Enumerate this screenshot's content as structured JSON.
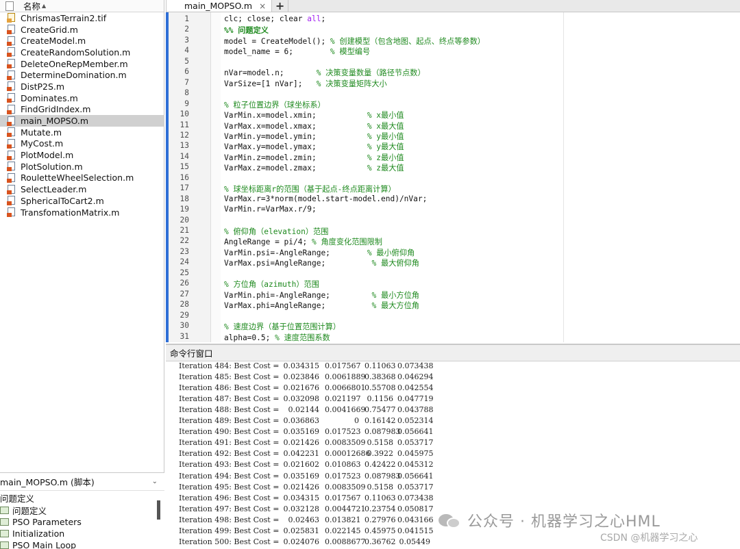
{
  "file_browser": {
    "header_label": "名称",
    "files": [
      {
        "name": "ChrismasTerrain2.tif",
        "type": "tif",
        "selected": false
      },
      {
        "name": "CreateGrid.m",
        "type": "m",
        "selected": false
      },
      {
        "name": "CreateModel.m",
        "type": "m",
        "selected": false
      },
      {
        "name": "CreateRandomSolution.m",
        "type": "m",
        "selected": false
      },
      {
        "name": "DeleteOneRepMember.m",
        "type": "m",
        "selected": false
      },
      {
        "name": "DetermineDomination.m",
        "type": "m",
        "selected": false
      },
      {
        "name": "DistP2S.m",
        "type": "m",
        "selected": false
      },
      {
        "name": "Dominates.m",
        "type": "m",
        "selected": false
      },
      {
        "name": "FindGridIndex.m",
        "type": "m",
        "selected": false
      },
      {
        "name": "main_MOPSO.m",
        "type": "m",
        "selected": true
      },
      {
        "name": "Mutate.m",
        "type": "m",
        "selected": false
      },
      {
        "name": "MyCost.m",
        "type": "m",
        "selected": false
      },
      {
        "name": "PlotModel.m",
        "type": "m",
        "selected": false
      },
      {
        "name": "PlotSolution.m",
        "type": "m",
        "selected": false
      },
      {
        "name": "RouletteWheelSelection.m",
        "type": "m",
        "selected": false
      },
      {
        "name": "SelectLeader.m",
        "type": "m",
        "selected": false
      },
      {
        "name": "SphericalToCart2.m",
        "type": "m",
        "selected": false
      },
      {
        "name": "TransfomationMatrix.m",
        "type": "m",
        "selected": false
      }
    ]
  },
  "script_panel": {
    "title": "main_MOPSO.m (脚本)",
    "root_section": "问题定义",
    "sections": [
      "问题定义",
      "PSO Parameters",
      "Initialization",
      "PSO Main Loop"
    ]
  },
  "editor": {
    "tab_label": "main_MOPSO.m",
    "tab_close": "×",
    "tab_add": "+",
    "lines": [
      {
        "n": "1",
        "code": "clc; close; clear all;"
      },
      {
        "n": "2",
        "code": "%% 问题定义"
      },
      {
        "n": "3",
        "code": "model = CreateModel(); % 创建模型（包含地图、起点、终点等参数）"
      },
      {
        "n": "4",
        "code": "model_name = 6;        % 模型编号"
      },
      {
        "n": "5",
        "code": ""
      },
      {
        "n": "6",
        "code": "nVar=model.n;       % 决策变量数量（路径节点数）"
      },
      {
        "n": "7",
        "code": "VarSize=[1 nVar];   % 决策变量矩阵大小"
      },
      {
        "n": "8",
        "code": ""
      },
      {
        "n": "9",
        "code": "% 粒子位置边界（球坐标系）"
      },
      {
        "n": "10",
        "code": "VarMin.x=model.xmin;           % x最小值"
      },
      {
        "n": "11",
        "code": "VarMax.x=model.xmax;           % x最大值"
      },
      {
        "n": "12",
        "code": "VarMin.y=model.ymin;           % y最小值"
      },
      {
        "n": "13",
        "code": "VarMax.y=model.ymax;           % y最大值"
      },
      {
        "n": "14",
        "code": "VarMin.z=model.zmin;           % z最小值"
      },
      {
        "n": "15",
        "code": "VarMax.z=model.zmax;           % z最大值"
      },
      {
        "n": "16",
        "code": ""
      },
      {
        "n": "17",
        "code": "% 球坐标距离r的范围（基于起点-终点距离计算）"
      },
      {
        "n": "18",
        "code": "VarMax.r=3*norm(model.start-model.end)/nVar;"
      },
      {
        "n": "19",
        "code": "VarMin.r=VarMax.r/9;"
      },
      {
        "n": "20",
        "code": ""
      },
      {
        "n": "21",
        "code": "% 俯仰角（elevation）范围"
      },
      {
        "n": "22",
        "code": "AngleRange = pi/4; % 角度变化范围限制"
      },
      {
        "n": "23",
        "code": "VarMin.psi=-AngleRange;        % 最小俯仰角"
      },
      {
        "n": "24",
        "code": "VarMax.psi=AngleRange;          % 最大俯仰角"
      },
      {
        "n": "25",
        "code": ""
      },
      {
        "n": "26",
        "code": "% 方位角（azimuth）范围"
      },
      {
        "n": "27",
        "code": "VarMin.phi=-AngleRange;         % 最小方位角"
      },
      {
        "n": "28",
        "code": "VarMax.phi=AngleRange;          % 最大方位角"
      },
      {
        "n": "29",
        "code": ""
      },
      {
        "n": "30",
        "code": "% 速度边界（基于位置范围计算）"
      },
      {
        "n": "31",
        "code": "alpha=0.5; % 速度范围系数"
      }
    ]
  },
  "command_window": {
    "title": "命令行窗口",
    "prompt": "«",
    "rows": [
      {
        "label": "Iteration 484: Best Cost =",
        "v": [
          "0.034315",
          "0.017567",
          "0.11063",
          "0.073438"
        ]
      },
      {
        "label": "Iteration 485: Best Cost =",
        "v": [
          "0.023846",
          "0.0061889",
          "0.38368",
          "0.046294"
        ]
      },
      {
        "label": "Iteration 486: Best Cost =",
        "v": [
          "0.021676",
          "0.0066801",
          "0.55708",
          "0.042554"
        ]
      },
      {
        "label": "Iteration 487: Best Cost =",
        "v": [
          "0.032098",
          "0.021197",
          "0.1156",
          "0.047719"
        ]
      },
      {
        "label": "Iteration 488: Best Cost =",
        "v": [
          "0.02144",
          "0.0041669",
          "0.75477",
          "0.043788"
        ]
      },
      {
        "label": "Iteration 489: Best Cost =",
        "v": [
          "0.036863",
          "0",
          "0.16142",
          "0.052314"
        ]
      },
      {
        "label": "Iteration 490: Best Cost =",
        "v": [
          "0.035169",
          "0.017523",
          "0.087983",
          "0.056641"
        ]
      },
      {
        "label": "Iteration 491: Best Cost =",
        "v": [
          "0.021426",
          "0.0083509",
          "0.5158",
          "0.053717"
        ]
      },
      {
        "label": "Iteration 492: Best Cost =",
        "v": [
          "0.042231",
          "0.00012686",
          "0.3922",
          "0.045975"
        ]
      },
      {
        "label": "Iteration 493: Best Cost =",
        "v": [
          "0.021602",
          "0.010863",
          "0.42422",
          "0.045312"
        ]
      },
      {
        "label": "Iteration 494: Best Cost =",
        "v": [
          "0.035169",
          "0.017523",
          "0.087983",
          "0.056641"
        ]
      },
      {
        "label": "Iteration 495: Best Cost =",
        "v": [
          "0.021426",
          "0.0083509",
          "0.5158",
          "0.053717"
        ]
      },
      {
        "label": "Iteration 496: Best Cost =",
        "v": [
          "0.034315",
          "0.017567",
          "0.11063",
          "0.073438"
        ]
      },
      {
        "label": "Iteration 497: Best Cost =",
        "v": [
          "0.032128",
          "0.0044721",
          "0.23754",
          "0.050817"
        ]
      },
      {
        "label": "Iteration 498: Best Cost =",
        "v": [
          "0.02463",
          "0.013821",
          "0.27976",
          "0.043166"
        ]
      },
      {
        "label": "Iteration 499: Best Cost =",
        "v": [
          "0.025831",
          "0.022145",
          "0.45975",
          "0.041515"
        ]
      },
      {
        "label": "Iteration 500: Best Cost =",
        "v": [
          "0.024076",
          "0.0088677",
          "0.36762",
          "0.05449"
        ]
      }
    ]
  },
  "watermark": {
    "text": "公众号 · 机器学习之心HML",
    "csdn": "CSDN @机器学习之心"
  },
  "colors": {
    "comment": "#1f8a1f",
    "keyword": "#0000ff",
    "string": "#a020f0",
    "selection": "#d0d0d0",
    "gutter_marker": "#2f6fd6"
  }
}
